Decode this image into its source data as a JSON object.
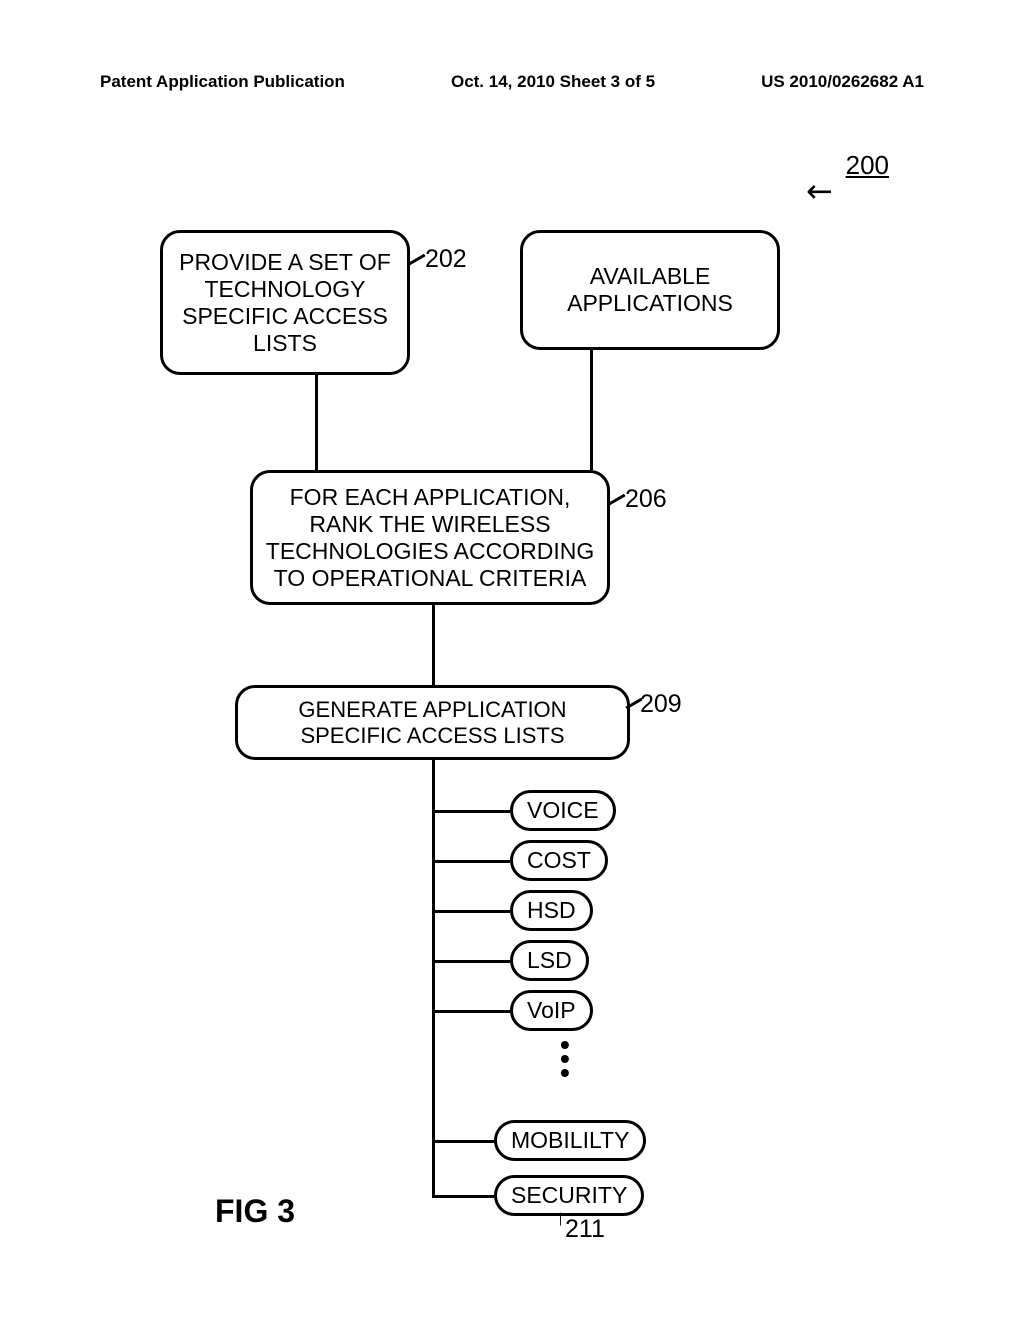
{
  "header": {
    "left": "Patent Application Publication",
    "center": "Oct. 14, 2010  Sheet 3 of 5",
    "right": "US 2010/0262682 A1"
  },
  "refs": {
    "r200": "200",
    "r202": "202",
    "r206": "206",
    "r209": "209",
    "r211": "211"
  },
  "boxes": {
    "b202": "PROVIDE A SET OF TECHNOLOGY SPECIFIC ACCESS LISTS",
    "b204": "AVAILABLE APPLICATIONS",
    "b206": "FOR EACH APPLICATION, RANK THE WIRELESS TECHNOLOGIES ACCORDING TO OPERATIONAL CRITERIA",
    "b209": "GENERATE APPLICATION SPECIFIC ACCESS LISTS"
  },
  "pills": {
    "voice": "VOICE",
    "cost": "COST",
    "hsd": "HSD",
    "lsd": "LSD",
    "voip": "VoIP",
    "mobility": "MOBILILTY",
    "security": "SECURITY"
  },
  "figure_label": "FIG 3"
}
